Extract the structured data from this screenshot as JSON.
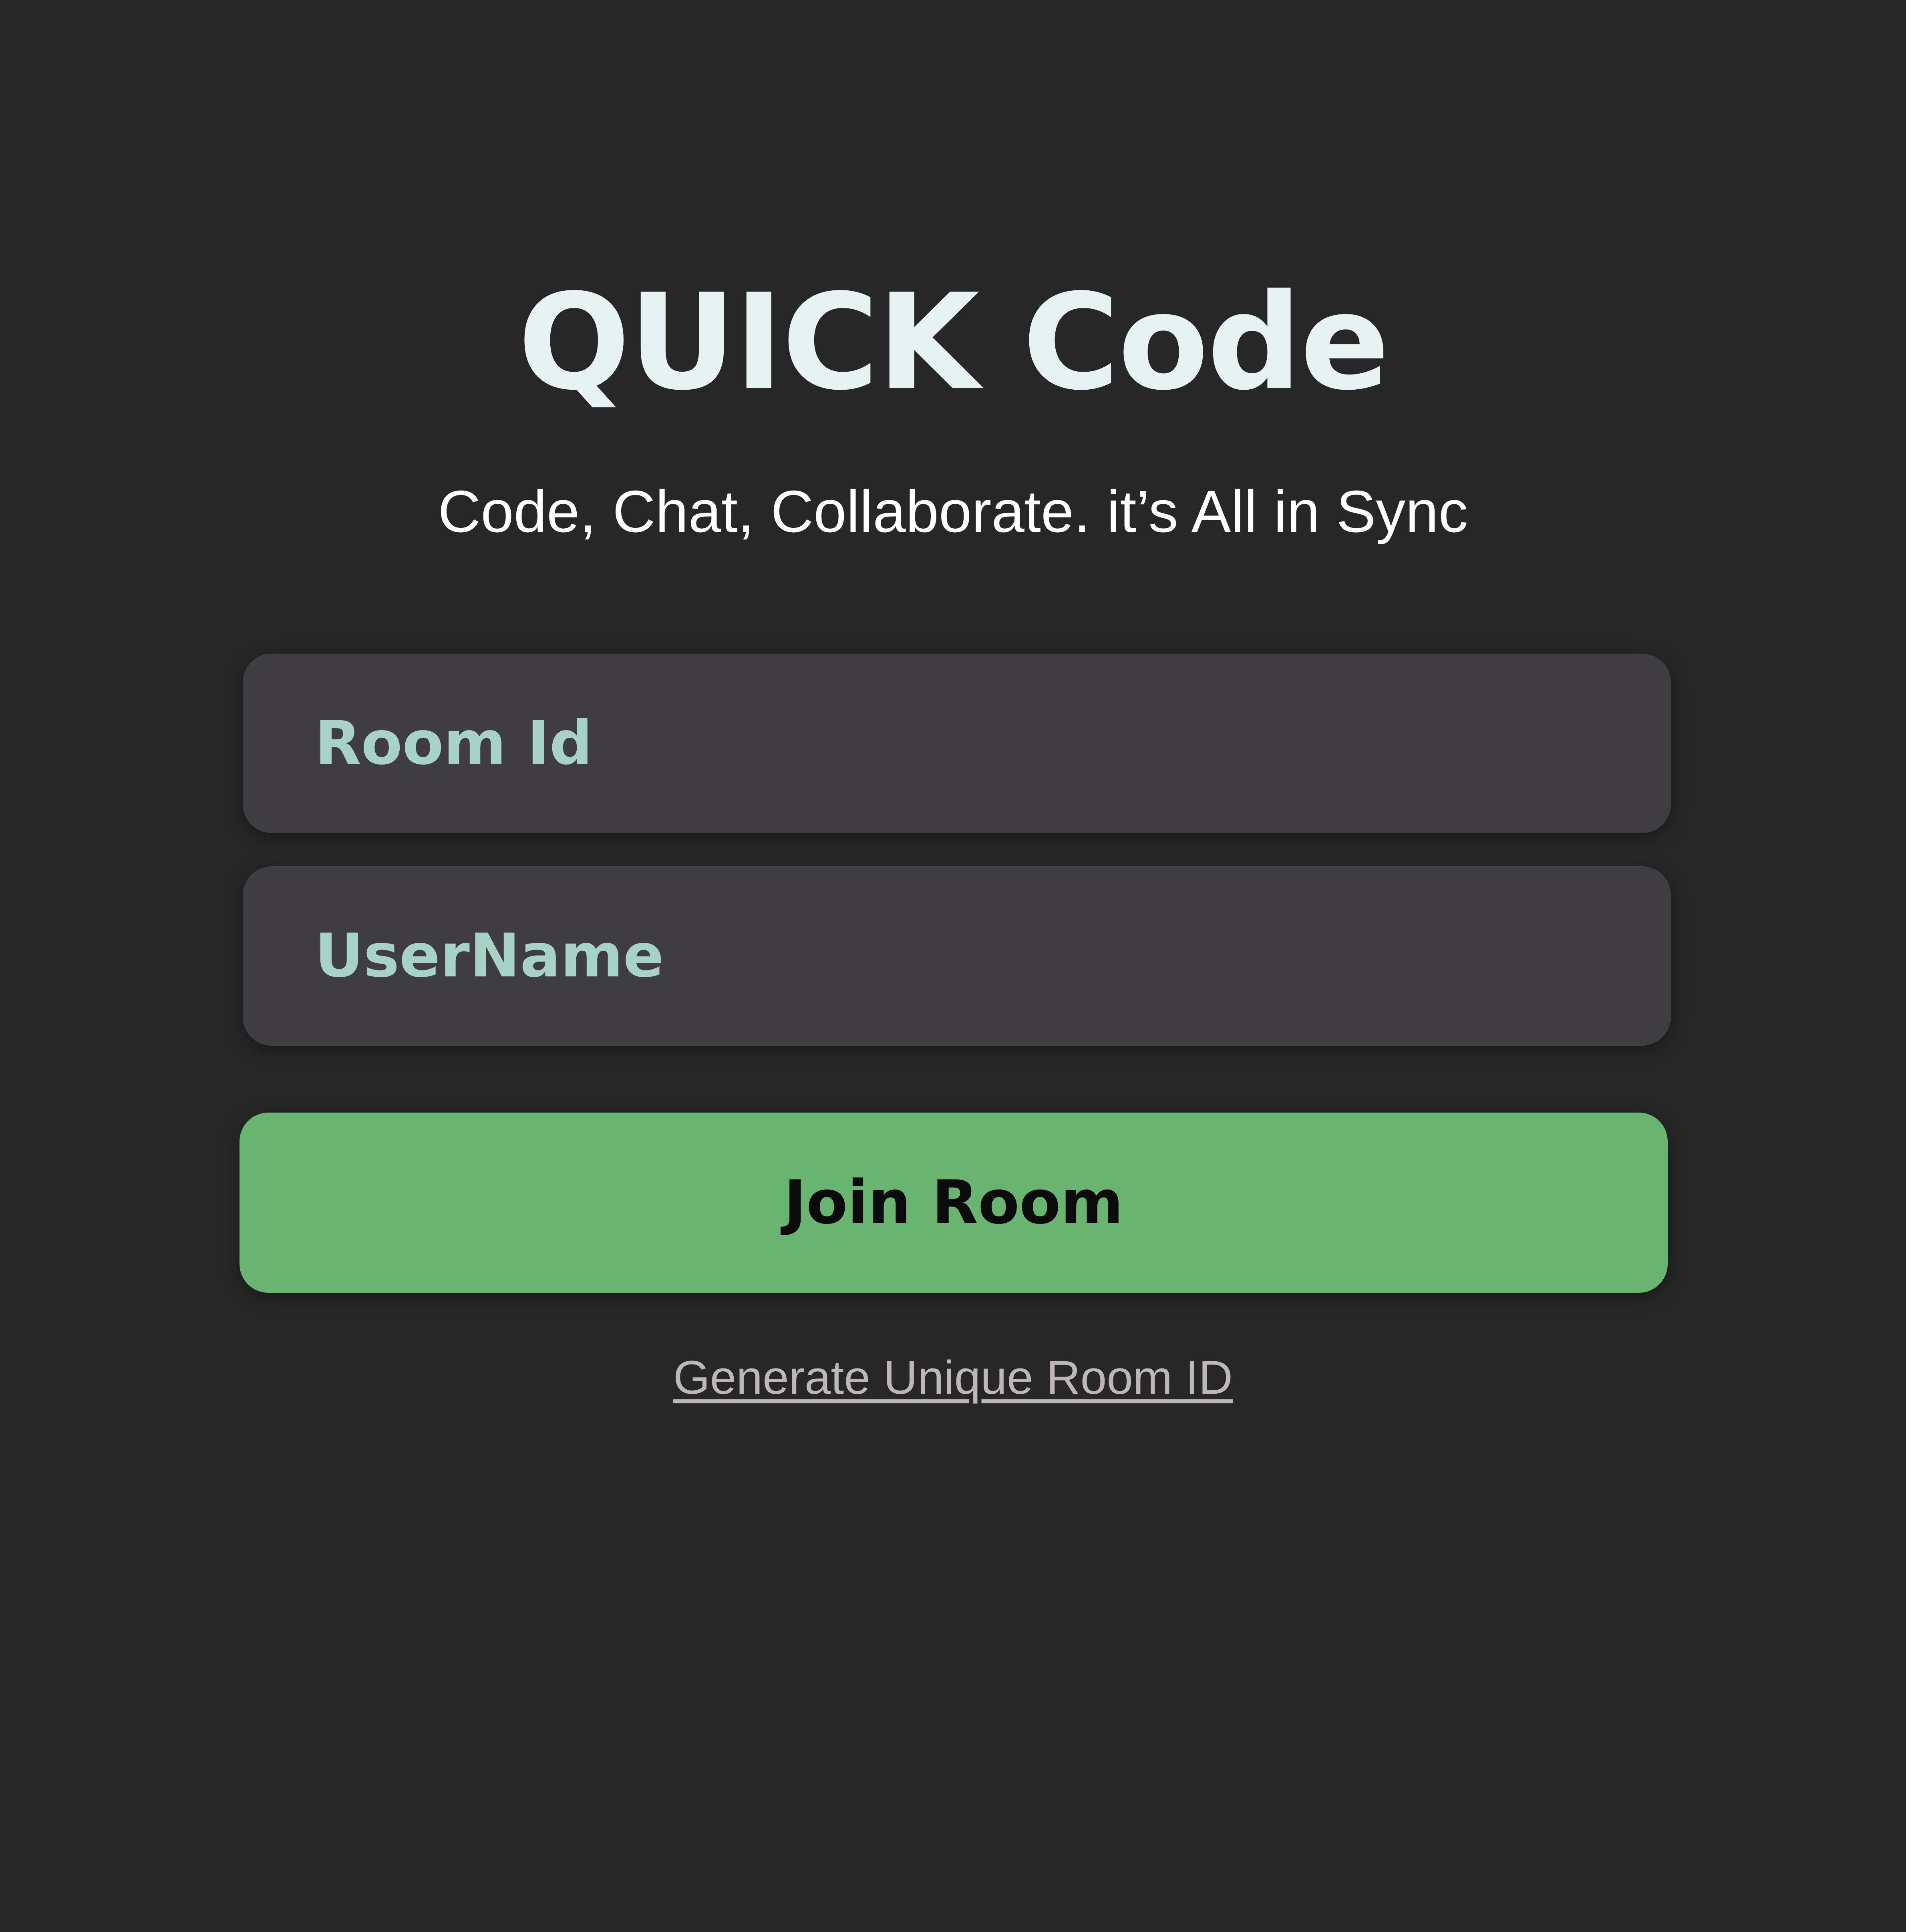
{
  "app": {
    "title": "QUICK Code",
    "tagline": "Code, Chat, Collaborate. it’s All in Sync"
  },
  "form": {
    "room_id_placeholder": "Room Id",
    "room_id_value": "",
    "username_placeholder": "UserName",
    "username_value": "",
    "join_label": "Join Room",
    "generate_link_label": "Generate Unique Room ID"
  },
  "colors": {
    "background": "#282728",
    "input_background": "#3f3d42",
    "placeholder_text": "#a7d3c6",
    "accent": "#69b471",
    "title_text": "#e7f2f3",
    "link_text": "#bdb7bb"
  }
}
